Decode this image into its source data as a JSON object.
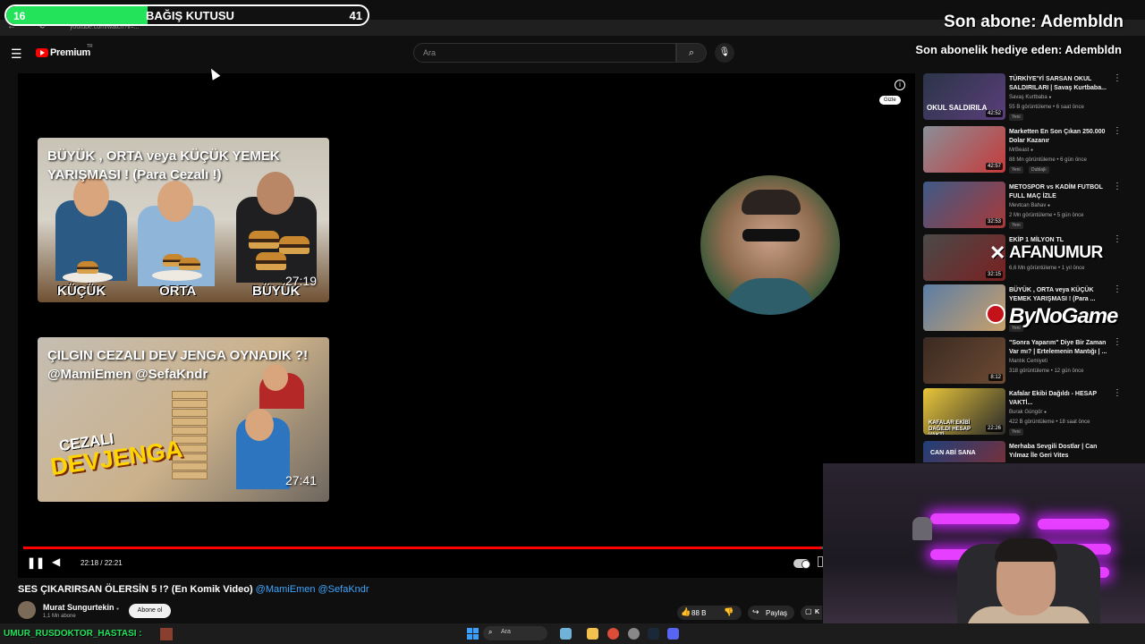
{
  "browser": {
    "url": "youtube.com/watch?v=...",
    "nav_back": "←",
    "nav_reload": "⟳"
  },
  "donation": {
    "current": "16",
    "title": "BAĞIŞ KUTUSU",
    "goal": "41",
    "progress": 0.39,
    "fill_color": "#22e35a"
  },
  "overlays": {
    "last_subscriber": "Son abone: Adembldn",
    "last_gift": "Son abonelik hediye eden: Adembldn",
    "sponsor_1": "AFANUMUR",
    "sponsor_2": "ByNoGame"
  },
  "header": {
    "menu_icon": "hamburger-icon",
    "brand": "Premium",
    "country": "TR",
    "search_placeholder": "Ara",
    "search_icon": "search-icon",
    "mic_icon": "mic-icon"
  },
  "player": {
    "hide_label": "Gizle",
    "endcards": [
      {
        "title": "BÜYÜK , ORTA veya KÜÇÜK YEMEK YARIŞMASI ! (Para Cezalı !)",
        "duration": "27:19",
        "labels": [
          "KÜÇÜK",
          "ORTA",
          "BÜYÜK"
        ]
      },
      {
        "title": "ÇILGIN CEZALI DEV JENGA OYNADIK ?! @MamiEmen @SefaKndr",
        "duration": "27:41",
        "overlay_1": "CEZALI",
        "overlay_2": "DEVJENGA"
      }
    ],
    "time": "22:18 / 22:21",
    "progress": 0.998,
    "accent": "#ff0000"
  },
  "video": {
    "title_main": "SES ÇIKARIRSAN ÖLERSİN 5 !? (En Komik Video) ",
    "title_mentions": "@MamiEmen @SefaKndr",
    "channel": "Murat Sungurtekin",
    "subscribers": "1,1 Mn abone",
    "subscribe_label": "Abone ol",
    "likes": "88 B",
    "share_label": "Paylaş",
    "save_label": "K"
  },
  "recommended": [
    {
      "title": "TÜRKİYE'Yİ SARSAN OKUL SALDIRILARI | Savaş Kurtbaba...",
      "channel": "Savaş Kurtbaba",
      "stats": "55 B görüntüleme • 6 saat önce",
      "badge": "Yeni",
      "duration": "42:52",
      "thumb_text": "OKUL SALDIRILA"
    },
    {
      "title": "Marketten En Son Çıkan 250.000 Dolar Kazanır",
      "channel": "MrBeast",
      "stats": "88 Mn görüntüleme • 6 gün önce",
      "badge": "Yeni",
      "badge2": "Dublajlı",
      "duration": "42:57"
    },
    {
      "title": "METOSPOR vs KADİM FUTBOL FULL MAÇ İZLE",
      "channel": "Mevtcan Bahav",
      "stats": "2 Mn görüntüleme • 5 gün önce",
      "badge": "Yeni",
      "duration": "32:53"
    },
    {
      "title": "EKİP 1 MİLYON TL",
      "channel": "",
      "stats": "6,6 Mn görüntüleme • 1 yıl önce",
      "badge": "",
      "duration": "32:15"
    },
    {
      "title": "BÜYÜK , ORTA veya KÜÇÜK YEMEK YARIŞMASI ! (Para ...",
      "channel": "",
      "stats": "",
      "badge": "Yeni",
      "duration": ""
    },
    {
      "title": "\"Sonra Yaparım\" Diye Bir Zaman Var mı? | Ertelemenin Mantığı | ...",
      "channel": "Mantık Cemiyeti",
      "stats": "318 görüntüleme • 12 gün önce",
      "badge": "",
      "duration": "8:12"
    },
    {
      "title": "Kafalar Ekibi Dağıldı - HESAP VAKTİ...",
      "channel": "Burak Güngör",
      "stats": "422 B görüntüleme • 18 saat önce",
      "badge": "Yeni",
      "duration": "22:26",
      "thumb_text": "KAFALAR EKİBİ DAĞILDI HESAP VAKTİ"
    },
    {
      "title": "Merhaba Sevgili Dostlar | Can Yılmaz İle Geri Vites",
      "channel": "",
      "stats": "",
      "badge": "",
      "duration": "",
      "thumb_text": "CAN ABİ SANA"
    }
  ],
  "ticker": {
    "user": "UMUR_RUSDOKTOR_HASTASI :"
  },
  "taskbar": {
    "search_text": "Ara"
  }
}
